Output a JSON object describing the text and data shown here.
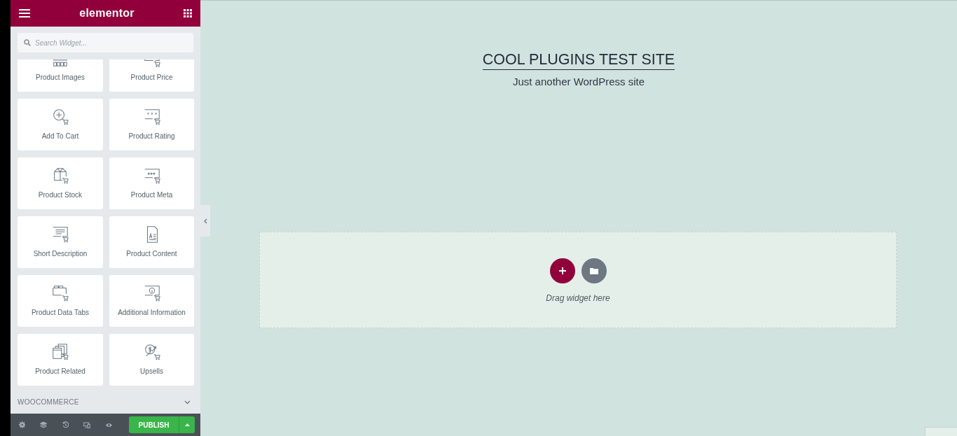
{
  "panel": {
    "logo": "elementor",
    "search": {
      "placeholder": "Search Widget..."
    },
    "widgets": [
      {
        "label": "Product Images",
        "kind": "images"
      },
      {
        "label": "Product Price",
        "kind": "price"
      },
      {
        "label": "Add To Cart",
        "kind": "add"
      },
      {
        "label": "Product Rating",
        "kind": "rating"
      },
      {
        "label": "Product Stock",
        "kind": "stock"
      },
      {
        "label": "Product Meta",
        "kind": "meta"
      },
      {
        "label": "Short Description",
        "kind": "short"
      },
      {
        "label": "Product Content",
        "kind": "content"
      },
      {
        "label": "Product Data Tabs",
        "kind": "tabs"
      },
      {
        "label": "Additional Information",
        "kind": "info"
      },
      {
        "label": "Product Related",
        "kind": "related"
      },
      {
        "label": "Upsells",
        "kind": "upsells"
      }
    ],
    "category": {
      "label": "WOOCOMMERCE",
      "expanded": false
    },
    "footer": {
      "publish": "PUBLISH"
    }
  },
  "canvas": {
    "site_title": "COOL PLUGINS TEST SITE",
    "tagline": "Just another WordPress site",
    "drop_hint": "Drag widget here"
  }
}
